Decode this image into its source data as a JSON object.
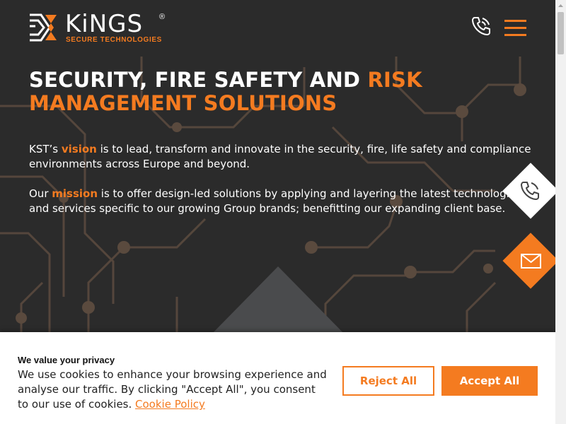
{
  "header": {
    "logo_text": "KiNGS",
    "logo_registered": "®",
    "logo_subtitle": "SECURE TECHNOLOGIES",
    "phone_icon": "phone-ringing-icon",
    "menu_icon": "hamburger-menu-icon"
  },
  "hero": {
    "title_part1": "SECURITY, FIRE SAFETY AND ",
    "title_accent_1": "RISK",
    "title_accent_2": "MANAGEMENT SOLUTIONS",
    "p1_before": "KST’s ",
    "p1_keyword": "vision",
    "p1_after": " is to lead, transform and innovate in the security, fire, life safety and compliance environments across Europe and beyond.",
    "p2_before": "Our ",
    "p2_keyword": "mission",
    "p2_after": " is to offer design-led solutions by applying and layering the latest technologies and services specific to our growing Group brands; benefitting our expanding client base."
  },
  "side_buttons": {
    "phone_icon": "phone-icon",
    "mail_icon": "envelope-icon"
  },
  "cookie": {
    "title": "We value your privacy",
    "text": "We use cookies to enhance your browsing experience and analyse our traffic. By clicking \"Accept All\", you consent to our use of cookies. ",
    "link": "Cookie Policy",
    "reject_label": "Reject All",
    "accept_label": "Accept All"
  },
  "colors": {
    "accent": "#f47b20",
    "background": "#2b2b2b",
    "text": "#ffffff"
  }
}
